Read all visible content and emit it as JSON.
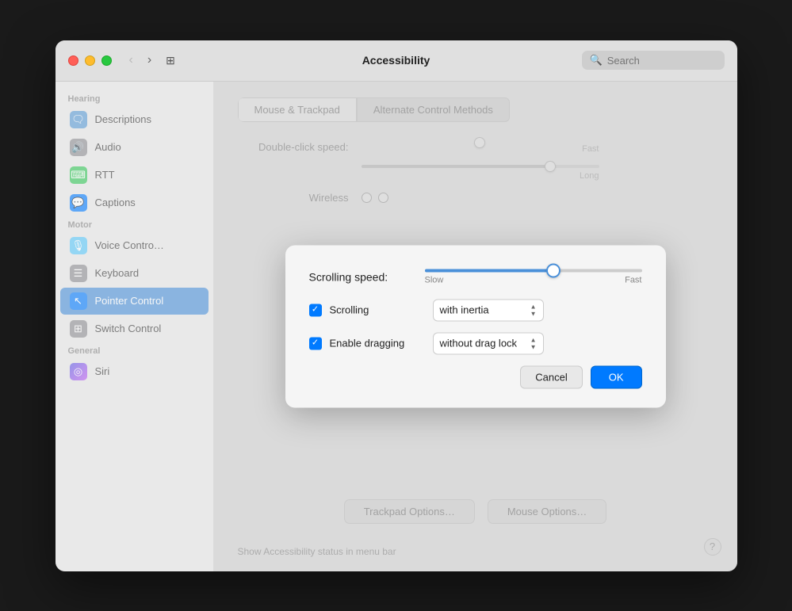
{
  "window": {
    "title": "Accessibility"
  },
  "titlebar": {
    "search_placeholder": "Search",
    "back_icon": "‹",
    "forward_icon": "›",
    "grid_icon": "⊞"
  },
  "sidebar": {
    "sections": [
      {
        "label": "Hearing",
        "items": [
          {
            "id": "descriptions",
            "label": "Descriptions",
            "icon": "🗨"
          },
          {
            "id": "audio",
            "label": "Audio",
            "icon": "🔊"
          },
          {
            "id": "rtt",
            "label": "RTT",
            "icon": "⌨"
          },
          {
            "id": "captions",
            "label": "Captions",
            "icon": "💬"
          }
        ]
      },
      {
        "label": "Motor",
        "items": [
          {
            "id": "voice-control",
            "label": "Voice Contro…",
            "icon": "🎙"
          },
          {
            "id": "keyboard",
            "label": "Keyboard",
            "icon": "☰"
          },
          {
            "id": "pointer-control",
            "label": "Pointer Control",
            "icon": "↖",
            "active": true
          },
          {
            "id": "switch-control",
            "label": "Switch Control",
            "icon": "⊞"
          }
        ]
      },
      {
        "label": "General",
        "items": [
          {
            "id": "siri",
            "label": "Siri",
            "icon": "◎"
          }
        ]
      }
    ]
  },
  "tabs": {
    "items": [
      {
        "id": "mouse-trackpad",
        "label": "Mouse & Trackpad",
        "active": true
      },
      {
        "id": "alternate-control",
        "label": "Alternate Control Methods"
      }
    ]
  },
  "main": {
    "double_click_label": "Double-click speed:",
    "fast_label": "Fast",
    "long_label": "Long",
    "wireless_label": "Wireless",
    "trackpad_options_btn": "Trackpad Options…",
    "mouse_options_btn": "Mouse Options…",
    "show_accessibility_label": "Show Accessibility status in menu bar"
  },
  "dialog": {
    "scrolling_speed_label": "Scrolling speed:",
    "slow_label": "Slow",
    "fast_label": "Fast",
    "scrolling_label": "Scrolling",
    "scrolling_value": "with inertia",
    "enable_dragging_label": "Enable dragging",
    "dragging_value": "without drag lock",
    "cancel_label": "Cancel",
    "ok_label": "OK",
    "slider_percent": 57
  },
  "icons": {
    "search": "🔍",
    "checkmark": "✓",
    "chevron_up": "▲",
    "chevron_down": "▼",
    "arrow_up": "▴",
    "arrow_down": "▾"
  }
}
